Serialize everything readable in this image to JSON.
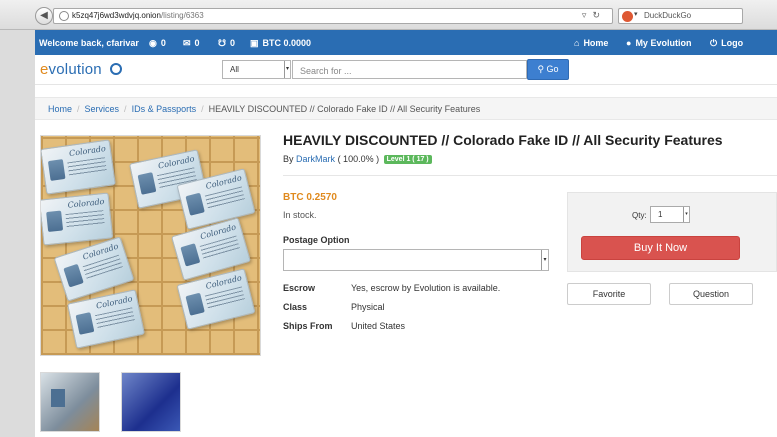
{
  "browser": {
    "url_host": "k5zq47j6wd3wdvjq.onion",
    "url_path": "/listing/6363",
    "search_engine": "DuckDuckGo"
  },
  "topnav": {
    "welcome": "Welcome back, cfarivar",
    "alerts_count": "0",
    "messages_count": "0",
    "cart_count": "0",
    "balance": "BTC 0.0000",
    "home_label": "Home",
    "account_label": "My Evolution",
    "logout_label": "Logo"
  },
  "header": {
    "logo_e": "e",
    "logo_rest": "volution",
    "category_selected": "All",
    "search_placeholder": "Search for ...",
    "go_label": "Go"
  },
  "breadcrumb": {
    "home": "Home",
    "services": "Services",
    "category": "IDs & Passports",
    "current": "HEAVILY DISCOUNTED // Colorado Fake ID // All Security Features"
  },
  "listing": {
    "title": "HEAVILY DISCOUNTED // Colorado Fake ID // All Security Features",
    "by_prefix": "By",
    "vendor": "DarkMark",
    "rating": "( 100.0% )",
    "level": "Level 1 ( 17 )",
    "price": "BTC 0.2570",
    "stock": "In stock.",
    "postage_label": "Postage Option",
    "postage_value": "",
    "image_card_text": "Colorado",
    "details": [
      {
        "key": "Escrow",
        "value": "Yes, escrow by Evolution is available."
      },
      {
        "key": "Class",
        "value": "Physical"
      },
      {
        "key": "Ships From",
        "value": "United States"
      }
    ]
  },
  "buy": {
    "qty_label": "Qty:",
    "qty_value": "1",
    "buy_label": "Buy It Now",
    "favorite_label": "Favorite",
    "question_label": "Question"
  },
  "colors": {
    "nav_blue": "#2a6db3",
    "price_orange": "#e08a1e",
    "buy_red": "#d9534f",
    "badge_green": "#5cb85c"
  }
}
